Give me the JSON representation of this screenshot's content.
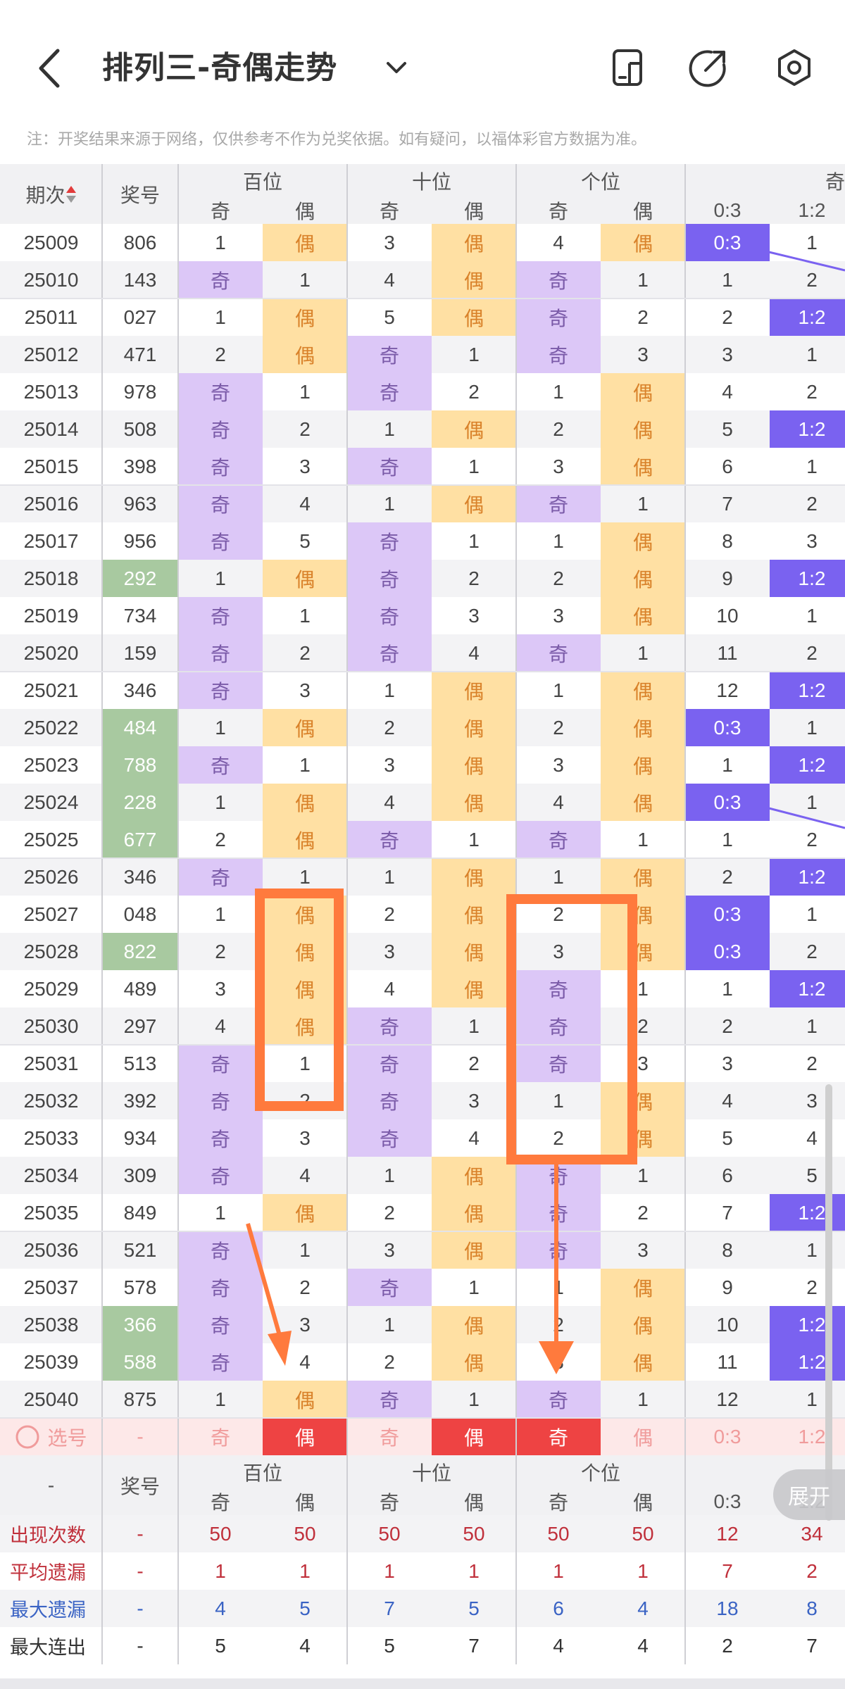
{
  "header": {
    "title": "排列三-奇偶走势",
    "notice": "注：开奖结果来源于网络，仅供参考不作为兑奖依据。如有疑问，以福体彩官方数据为准。"
  },
  "table": {
    "group_headers": [
      "百位",
      "十位",
      "个位",
      "奇"
    ],
    "sub_headers": [
      "奇",
      "偶",
      "奇",
      "偶",
      "奇",
      "偶",
      "0:3",
      "1:2"
    ],
    "period_header": "期次",
    "number_header": "奖号",
    "rows": [
      {
        "period": "25009",
        "num": "806",
        "green": false,
        "cells": [
          "1",
          "偶",
          "3",
          "偶",
          "4",
          "偶",
          "0:3",
          "1"
        ]
      },
      {
        "period": "25010",
        "num": "143",
        "green": false,
        "cells": [
          "奇",
          "1",
          "4",
          "偶",
          "奇",
          "1",
          "1",
          "2"
        ]
      },
      {
        "period": "25011",
        "num": "027",
        "green": false,
        "cells": [
          "1",
          "偶",
          "5",
          "偶",
          "奇",
          "2",
          "2",
          "1:2"
        ]
      },
      {
        "period": "25012",
        "num": "471",
        "green": false,
        "cells": [
          "2",
          "偶",
          "奇",
          "1",
          "奇",
          "3",
          "3",
          "1"
        ]
      },
      {
        "period": "25013",
        "num": "978",
        "green": false,
        "cells": [
          "奇",
          "1",
          "奇",
          "2",
          "1",
          "偶",
          "4",
          "2"
        ]
      },
      {
        "period": "25014",
        "num": "508",
        "green": false,
        "cells": [
          "奇",
          "2",
          "1",
          "偶",
          "2",
          "偶",
          "5",
          "1:2"
        ]
      },
      {
        "period": "25015",
        "num": "398",
        "green": false,
        "cells": [
          "奇",
          "3",
          "奇",
          "1",
          "3",
          "偶",
          "6",
          "1"
        ]
      },
      {
        "period": "25016",
        "num": "963",
        "green": false,
        "cells": [
          "奇",
          "4",
          "1",
          "偶",
          "奇",
          "1",
          "7",
          "2"
        ]
      },
      {
        "period": "25017",
        "num": "956",
        "green": false,
        "cells": [
          "奇",
          "5",
          "奇",
          "1",
          "1",
          "偶",
          "8",
          "3"
        ]
      },
      {
        "period": "25018",
        "num": "292",
        "green": true,
        "cells": [
          "1",
          "偶",
          "奇",
          "2",
          "2",
          "偶",
          "9",
          "1:2"
        ]
      },
      {
        "period": "25019",
        "num": "734",
        "green": false,
        "cells": [
          "奇",
          "1",
          "奇",
          "3",
          "3",
          "偶",
          "10",
          "1"
        ]
      },
      {
        "period": "25020",
        "num": "159",
        "green": false,
        "cells": [
          "奇",
          "2",
          "奇",
          "4",
          "奇",
          "1",
          "11",
          "2"
        ]
      },
      {
        "period": "25021",
        "num": "346",
        "green": false,
        "cells": [
          "奇",
          "3",
          "1",
          "偶",
          "1",
          "偶",
          "12",
          "1:2"
        ]
      },
      {
        "period": "25022",
        "num": "484",
        "green": true,
        "cells": [
          "1",
          "偶",
          "2",
          "偶",
          "2",
          "偶",
          "0:3",
          "1"
        ]
      },
      {
        "period": "25023",
        "num": "788",
        "green": true,
        "cells": [
          "奇",
          "1",
          "3",
          "偶",
          "3",
          "偶",
          "1",
          "1:2"
        ]
      },
      {
        "period": "25024",
        "num": "228",
        "green": true,
        "cells": [
          "1",
          "偶",
          "4",
          "偶",
          "4",
          "偶",
          "0:3",
          "1"
        ]
      },
      {
        "period": "25025",
        "num": "677",
        "green": true,
        "cells": [
          "2",
          "偶",
          "奇",
          "1",
          "奇",
          "1",
          "1",
          "2"
        ]
      },
      {
        "period": "25026",
        "num": "346",
        "green": false,
        "cells": [
          "奇",
          "1",
          "1",
          "偶",
          "1",
          "偶",
          "2",
          "1:2"
        ]
      },
      {
        "period": "25027",
        "num": "048",
        "green": false,
        "cells": [
          "1",
          "偶",
          "2",
          "偶",
          "2",
          "偶",
          "0:3",
          "1"
        ]
      },
      {
        "period": "25028",
        "num": "822",
        "green": true,
        "cells": [
          "2",
          "偶",
          "3",
          "偶",
          "3",
          "偶",
          "0:3",
          "2"
        ]
      },
      {
        "period": "25029",
        "num": "489",
        "green": false,
        "cells": [
          "3",
          "偶",
          "4",
          "偶",
          "奇",
          "1",
          "1",
          "1:2"
        ]
      },
      {
        "period": "25030",
        "num": "297",
        "green": false,
        "cells": [
          "4",
          "偶",
          "奇",
          "1",
          "奇",
          "2",
          "2",
          "1"
        ]
      },
      {
        "period": "25031",
        "num": "513",
        "green": false,
        "cells": [
          "奇",
          "1",
          "奇",
          "2",
          "奇",
          "3",
          "3",
          "2"
        ]
      },
      {
        "period": "25032",
        "num": "392",
        "green": false,
        "cells": [
          "奇",
          "2",
          "奇",
          "3",
          "1",
          "偶",
          "4",
          "3"
        ]
      },
      {
        "period": "25033",
        "num": "934",
        "green": false,
        "cells": [
          "奇",
          "3",
          "奇",
          "4",
          "2",
          "偶",
          "5",
          "4"
        ]
      },
      {
        "period": "25034",
        "num": "309",
        "green": false,
        "cells": [
          "奇",
          "4",
          "1",
          "偶",
          "奇",
          "1",
          "6",
          "5"
        ]
      },
      {
        "period": "25035",
        "num": "849",
        "green": false,
        "cells": [
          "1",
          "偶",
          "2",
          "偶",
          "奇",
          "2",
          "7",
          "1:2"
        ]
      },
      {
        "period": "25036",
        "num": "521",
        "green": false,
        "cells": [
          "奇",
          "1",
          "3",
          "偶",
          "奇",
          "3",
          "8",
          "1"
        ]
      },
      {
        "period": "25037",
        "num": "578",
        "green": false,
        "cells": [
          "奇",
          "2",
          "奇",
          "1",
          "1",
          "偶",
          "9",
          "2"
        ]
      },
      {
        "period": "25038",
        "num": "366",
        "green": true,
        "cells": [
          "奇",
          "3",
          "1",
          "偶",
          "2",
          "偶",
          "10",
          "1:2"
        ]
      },
      {
        "period": "25039",
        "num": "588",
        "green": true,
        "cells": [
          "奇",
          "4",
          "2",
          "偶",
          "3",
          "偶",
          "11",
          "1:2"
        ]
      },
      {
        "period": "25040",
        "num": "875",
        "green": false,
        "cells": [
          "1",
          "偶",
          "奇",
          "1",
          "奇",
          "1",
          "12",
          "1"
        ]
      }
    ],
    "select_row": {
      "label": "选号",
      "num": "-",
      "cells": [
        "奇",
        "偶",
        "奇",
        "偶",
        "奇",
        "偶",
        "0:3",
        "1:2"
      ]
    },
    "footer_number_header": "奖号",
    "footer_dash": "-",
    "stats": [
      {
        "label": "出现次数",
        "num": "-",
        "values": [
          "50",
          "50",
          "50",
          "50",
          "50",
          "50",
          "12",
          "34"
        ]
      },
      {
        "label": "平均遗漏",
        "num": "-",
        "values": [
          "1",
          "1",
          "1",
          "1",
          "1",
          "1",
          "7",
          "2"
        ]
      },
      {
        "label": "最大遗漏",
        "num": "-",
        "values": [
          "4",
          "5",
          "7",
          "5",
          "6",
          "4",
          "18",
          "8"
        ]
      },
      {
        "label": "最大连出",
        "num": "-",
        "values": [
          "5",
          "4",
          "5",
          "7",
          "4",
          "4",
          "2",
          "7"
        ]
      }
    ]
  },
  "expand_button": "展开",
  "colors": {
    "odd_cell": "#dcc7f7",
    "even_cell": "#ffe0a3",
    "green": "#a8c9a0",
    "blue": "#7a62f0",
    "select_red": "#ee4343",
    "annotation": "#ff7a3d"
  },
  "icons": [
    "back-arrow-icon",
    "caret-down-icon",
    "phone-layout-icon",
    "share-arrow-icon",
    "settings-hexagon-icon",
    "sort-icon",
    "circle-checkbox-icon"
  ]
}
